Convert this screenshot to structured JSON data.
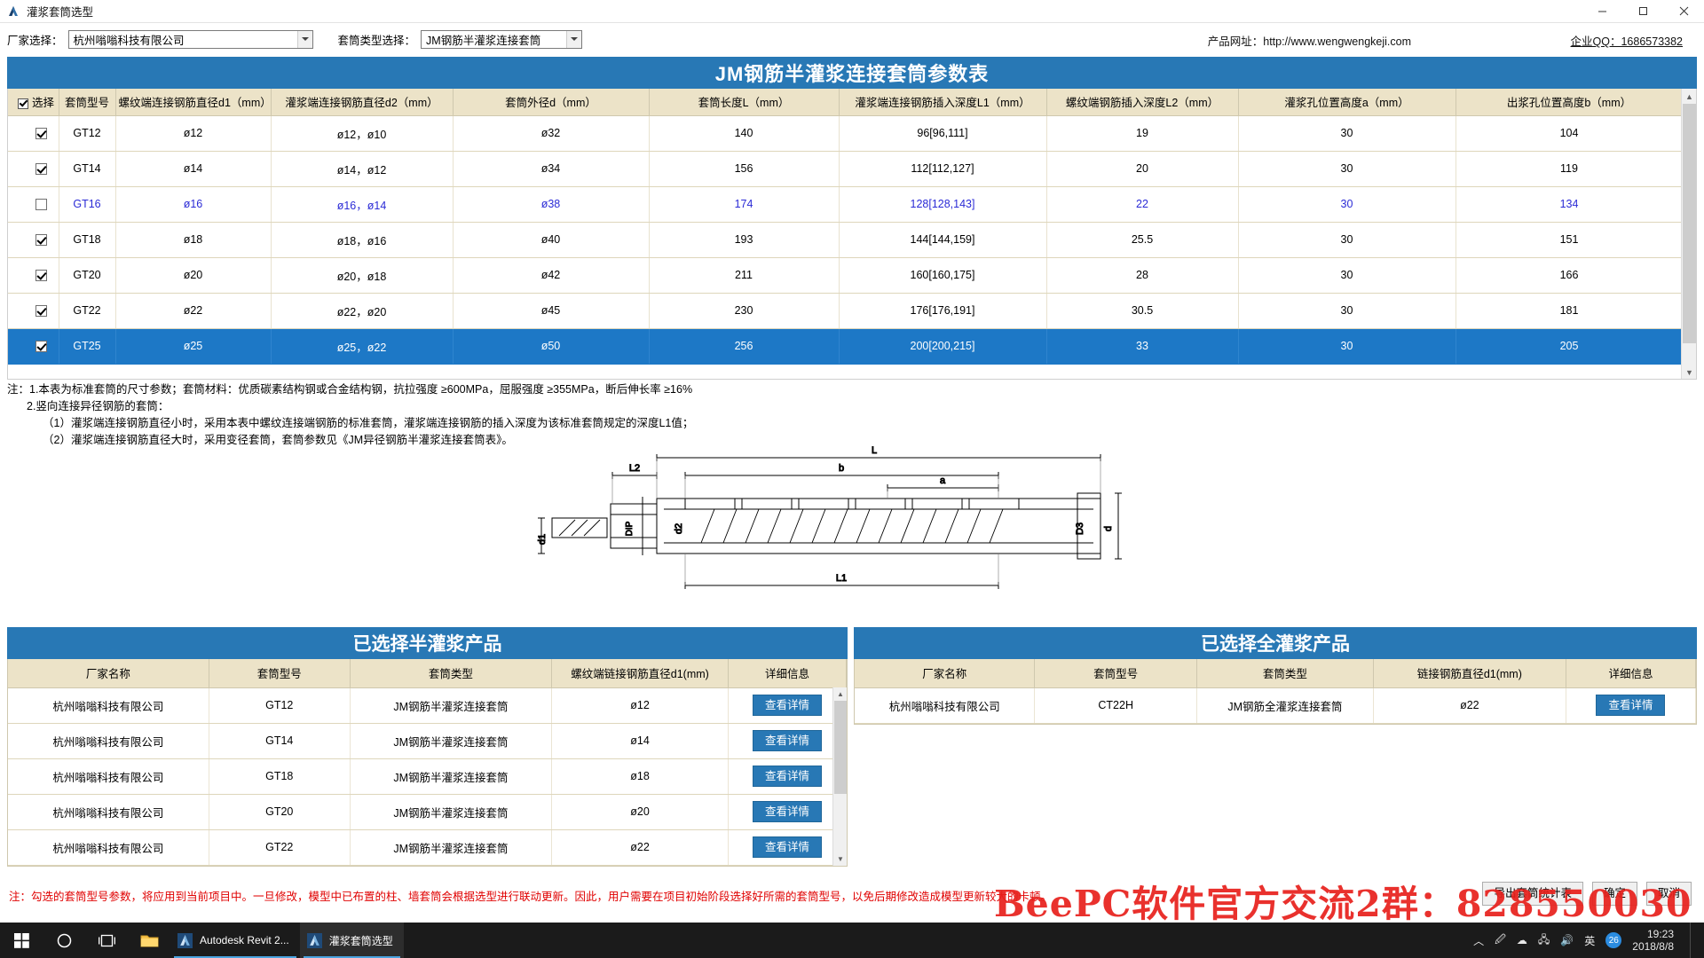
{
  "window": {
    "title": "灌浆套筒选型",
    "icon": "revit-app-icon",
    "minimize": "minimize-icon",
    "maximize": "maximize-icon",
    "close": "close-icon"
  },
  "toolbar": {
    "mfr_label": "厂家选择：",
    "mfr_value": "杭州嗡嗡科技有限公司",
    "type_label": "套筒类型选择：",
    "type_value": "JM钢筋半灌浆连接套筒",
    "site": "产品网址：http://www.wengwengkeji.com",
    "qq": "企业QQ：1686573382"
  },
  "banner": {
    "title": "JM钢筋半灌浆连接套筒参数表"
  },
  "main_table": {
    "headers": [
      "选择",
      "套筒型号",
      "螺纹端连接钢筋直径d1（mm）",
      "灌浆端连接钢筋直径d2（mm）",
      "套筒外径d（mm）",
      "套筒长度L（mm）",
      "灌浆端连接钢筋插入深度L1（mm）",
      "螺纹端钢筋插入深度L2（mm）",
      "灌浆孔位置高度a（mm）",
      "出浆孔位置高度b（mm）"
    ],
    "rows": [
      {
        "checked": true,
        "state": "normal",
        "model": "GT12",
        "d1": "ø12",
        "d2": "ø12，ø10",
        "d": "ø32",
        "L": "140",
        "L1": "96[96,111]",
        "L2": "19",
        "a": "30",
        "b": "104"
      },
      {
        "checked": true,
        "state": "normal",
        "model": "GT14",
        "d1": "ø14",
        "d2": "ø14，ø12",
        "d": "ø34",
        "L": "156",
        "L1": "112[112,127]",
        "L2": "20",
        "a": "30",
        "b": "119"
      },
      {
        "checked": false,
        "state": "hover",
        "model": "GT16",
        "d1": "ø16",
        "d2": "ø16，ø14",
        "d": "ø38",
        "L": "174",
        "L1": "128[128,143]",
        "L2": "22",
        "a": "30",
        "b": "134"
      },
      {
        "checked": true,
        "state": "normal",
        "model": "GT18",
        "d1": "ø18",
        "d2": "ø18，ø16",
        "d": "ø40",
        "L": "193",
        "L1": "144[144,159]",
        "L2": "25.5",
        "a": "30",
        "b": "151"
      },
      {
        "checked": true,
        "state": "normal",
        "model": "GT20",
        "d1": "ø20",
        "d2": "ø20，ø18",
        "d": "ø42",
        "L": "211",
        "L1": "160[160,175]",
        "L2": "28",
        "a": "30",
        "b": "166"
      },
      {
        "checked": true,
        "state": "normal",
        "model": "GT22",
        "d1": "ø22",
        "d2": "ø22，ø20",
        "d": "ø45",
        "L": "230",
        "L1": "176[176,191]",
        "L2": "30.5",
        "a": "30",
        "b": "181"
      },
      {
        "checked": true,
        "state": "selected",
        "model": "GT25",
        "d1": "ø25",
        "d2": "ø25，ø22",
        "d": "ø50",
        "L": "256",
        "L1": "200[200,215]",
        "L2": "33",
        "a": "30",
        "b": "205"
      }
    ]
  },
  "notes": {
    "line1": "注：1.本表为标准套筒的尺寸参数；套筒材料：优质碳素结构钢或合金结构钢，抗拉强度 ≥600MPa，屈服强度 ≥355MPa，断后伸长率 ≥16%",
    "line2": "2.竖向连接异径钢筋的套筒：",
    "line3": "（1）灌浆端连接钢筋直径小时，采用本表中螺纹连接端钢筋的标准套筒，灌浆端连接钢筋的插入深度为该标准套筒规定的深度L1值；",
    "line4": "（2）灌浆端连接钢筋直径大时，采用变径套筒，套筒参数见《JM异径钢筋半灌浆连接套筒表》。"
  },
  "diagram": {
    "labels": [
      "L",
      "b",
      "a",
      "L2",
      "L1",
      "d1",
      "d2",
      "D3",
      "d",
      "DIP"
    ]
  },
  "half_panel": {
    "title": "已选择半灌浆产品",
    "headers": [
      "厂家名称",
      "套筒型号",
      "套筒类型",
      "螺纹端链接钢筋直径d1(mm)",
      "详细信息"
    ],
    "rows": [
      {
        "mfr": "杭州嗡嗡科技有限公司",
        "model": "GT12",
        "type": "JM钢筋半灌浆连接套筒",
        "d1": "ø12",
        "btn": "查看详情"
      },
      {
        "mfr": "杭州嗡嗡科技有限公司",
        "model": "GT14",
        "type": "JM钢筋半灌浆连接套筒",
        "d1": "ø14",
        "btn": "查看详情"
      },
      {
        "mfr": "杭州嗡嗡科技有限公司",
        "model": "GT18",
        "type": "JM钢筋半灌浆连接套筒",
        "d1": "ø18",
        "btn": "查看详情"
      },
      {
        "mfr": "杭州嗡嗡科技有限公司",
        "model": "GT20",
        "type": "JM钢筋半灌浆连接套筒",
        "d1": "ø20",
        "btn": "查看详情"
      },
      {
        "mfr": "杭州嗡嗡科技有限公司",
        "model": "GT22",
        "type": "JM钢筋半灌浆连接套筒",
        "d1": "ø22",
        "btn": "查看详情"
      }
    ]
  },
  "full_panel": {
    "title": "已选择全灌浆产品",
    "headers": [
      "厂家名称",
      "套筒型号",
      "套筒类型",
      "链接钢筋直径d1(mm)",
      "详细信息"
    ],
    "rows": [
      {
        "mfr": "杭州嗡嗡科技有限公司",
        "model": "CT22H",
        "type": "JM钢筋全灌浆连接套筒",
        "d1": "ø22",
        "btn": "查看详情"
      }
    ]
  },
  "footer": {
    "note": "注：勾选的套筒型号参数，将应用到当前项目中。一旦修改，模型中已布置的柱、墙套筒会根据选型进行联动更新。因此，用户需要在项目初始阶段选择好所需的套筒型号，以免后期修改造成模型更新较大的卡顿。",
    "export_btn": "导出套筒统计表",
    "ok_btn": "确定",
    "cancel_btn": "取消",
    "watermark": "BeePC软件官方交流2群：828550030"
  },
  "taskbar": {
    "start": "start-icon",
    "search": "cortana-icon",
    "taskview": "task-view-icon",
    "explorer": "file-explorer-icon",
    "apps": [
      {
        "label": "Autodesk Revit 2...",
        "icon": "revit-app-icon",
        "active": false
      },
      {
        "label": "灌浆套筒选型",
        "icon": "revit-app-icon",
        "active": true
      }
    ],
    "tray_ime": "英",
    "tray_badge": "26",
    "time": "19:23",
    "date": "2018/8/8"
  },
  "colors": {
    "accent_blue": "#2878b5",
    "header_tan": "#ece3c8",
    "selected_row": "#1d78c6",
    "hover_text": "#2b2bd6",
    "red_note": "#e00000",
    "watermark_red": "#e8201c"
  }
}
